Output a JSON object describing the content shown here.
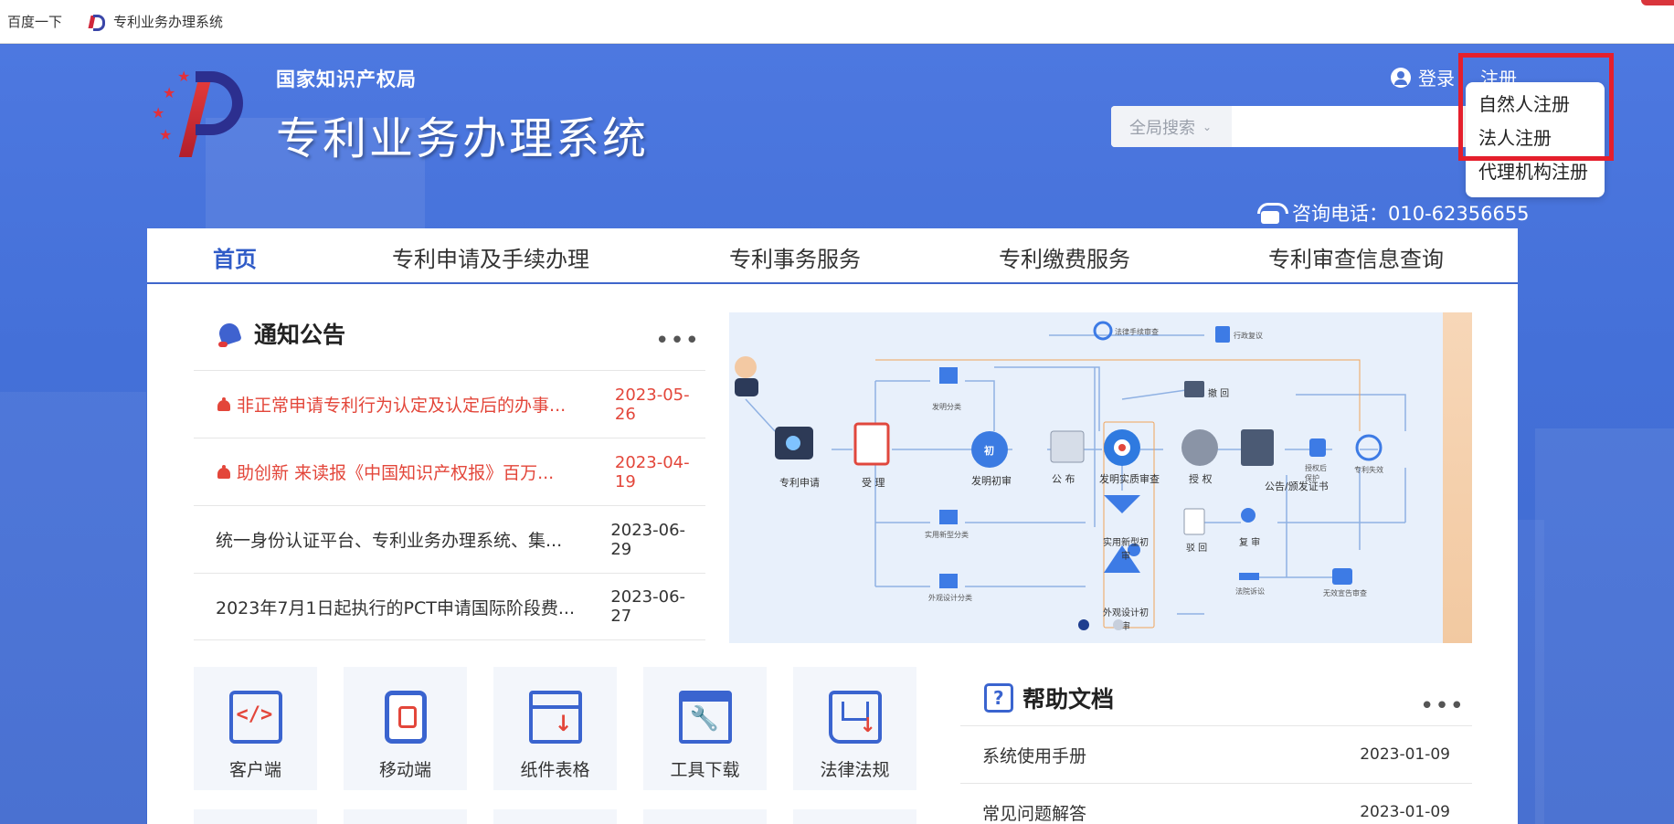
{
  "bookmarks": [
    {
      "label": "百度一下"
    },
    {
      "label": "专利业务办理系统"
    }
  ],
  "header": {
    "org_name": "国家知识产权局",
    "system_name": "专利业务办理系统",
    "login_label": "登录",
    "register_label": "注册",
    "search_scope": "全局搜索",
    "search_placeholder": "",
    "hotline": "咨询电话：010-62356655"
  },
  "register_menu": {
    "items": [
      "自然人注册",
      "法人注册",
      "代理机构注册"
    ]
  },
  "nav": {
    "items": [
      "首页",
      "专利申请及手续办理",
      "专利事务服务",
      "专利缴费服务",
      "专利审查信息查询"
    ],
    "active": "首页"
  },
  "notices": {
    "title": "通知公告",
    "more": "•••",
    "items": [
      {
        "title": "非正常申请专利行为认定及认定后的办事...",
        "date": "2023-05-26",
        "hot": true
      },
      {
        "title": "助创新 来读报《中国知识产权报》百万...",
        "date": "2023-04-19",
        "hot": true
      },
      {
        "title": "统一身份认证平台、专利业务办理系统、集...",
        "date": "2023-06-29",
        "hot": false
      },
      {
        "title": "2023年7月1日起执行的PCT申请国际阶段费...",
        "date": "2023-06-27",
        "hot": false
      }
    ]
  },
  "flowchart": {
    "nodes": {
      "apply": "专利申请",
      "accept": "受 理",
      "prelim": "发明初审",
      "prelim_badge": "初",
      "publish": "公 布",
      "substantive": "发明实质审查",
      "grant": "授 权",
      "certificate": "公告/颁发证书",
      "protect": "授权后保护",
      "expire": "专利失效",
      "invention_class": "发明分类",
      "utility_class": "实用新型分类",
      "design_class": "外观设计分类",
      "utility_prelim": "实用新型初审",
      "design_prelim": "外观设计初审",
      "withdraw": "撤 回",
      "reject": "驳 回",
      "reexam": "复 审",
      "court": "法院诉讼",
      "invalid": "无效宣告审查",
      "legal_proc": "法律手续审查",
      "admin_review": "行政复议"
    }
  },
  "quick_links": [
    {
      "label": "客户端",
      "icon": "client-icon"
    },
    {
      "label": "移动端",
      "icon": "mobile-icon"
    },
    {
      "label": "纸件表格",
      "icon": "form-icon"
    },
    {
      "label": "工具下载",
      "icon": "tool-icon"
    },
    {
      "label": "法律法规",
      "icon": "law-icon"
    }
  ],
  "help": {
    "title": "帮助文档",
    "more": "•••",
    "items": [
      {
        "title": "系统使用手册",
        "date": "2023-01-09"
      },
      {
        "title": "常见问题解答",
        "date": "2023-01-09"
      }
    ]
  },
  "colors": {
    "brand_blue": "#4a73d6",
    "nav_active": "#2f5bc7",
    "hot_red": "#e3463a",
    "highlight_red": "#e51f2c"
  }
}
